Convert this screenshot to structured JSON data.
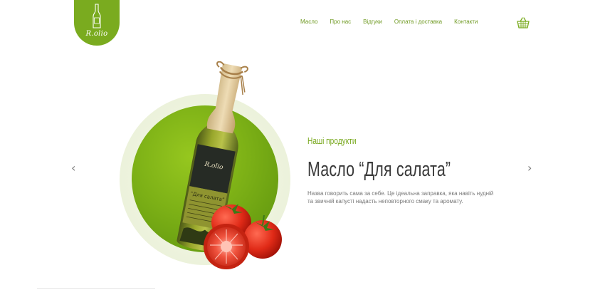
{
  "logo": {
    "text": "R.olio"
  },
  "nav": {
    "items": [
      "Масло",
      "Про нас",
      "Відгуки",
      "Оплата і доставка",
      "Контакти"
    ]
  },
  "cart": {
    "icon": "basket-icon"
  },
  "hero": {
    "eyebrow": "Наші продукти",
    "title": "Масло “Для салата”",
    "description": "Назва говорить сама за себе. Це ідеальна заправка, яка навіть нудній та звичній капусті надасть неповторного смаку та аромату.",
    "bottle_label_brand": "R.olio",
    "bottle_label_name": "“Для салата”"
  },
  "carousel": {
    "prev": "‹",
    "next": "›"
  },
  "colors": {
    "accent": "#7aab1f",
    "title": "#3a3a3a",
    "text": "#777777"
  }
}
